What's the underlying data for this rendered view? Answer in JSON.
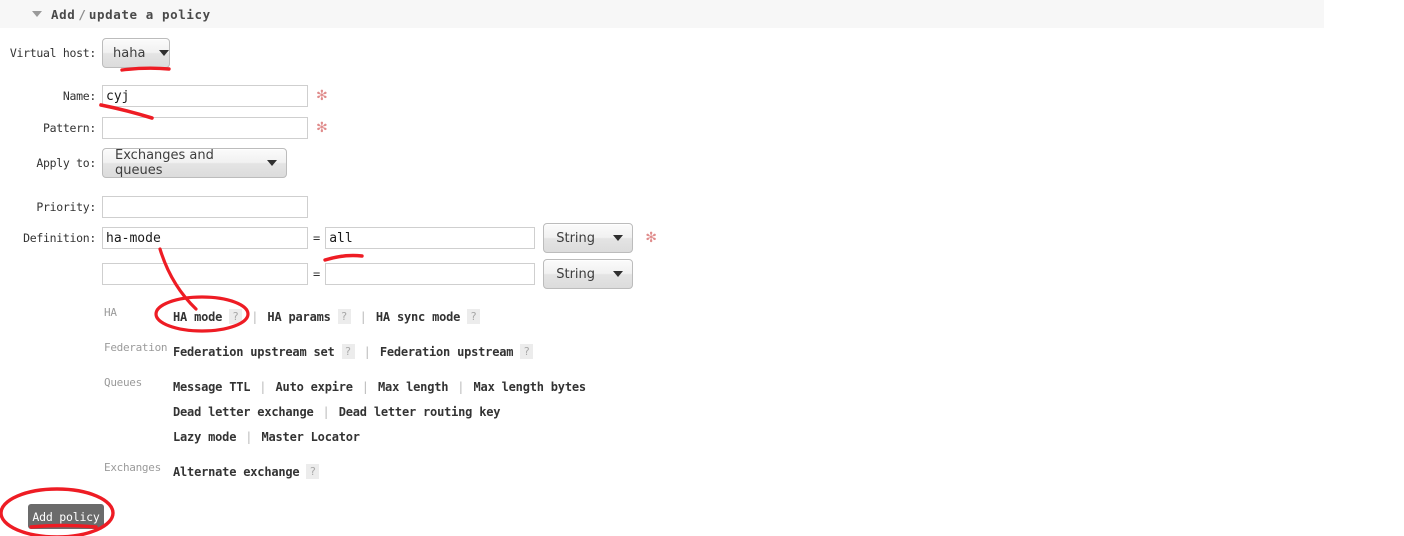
{
  "header": {
    "disclosure_icon": "triangle-down-icon",
    "title_first": "Add",
    "separator": "/",
    "title_rest": "update a policy"
  },
  "form": {
    "virtual_host": {
      "label": "Virtual host:",
      "value": "haha",
      "caret_icon": "chevron-down-icon"
    },
    "name": {
      "label": "Name:",
      "value": "cyj",
      "placeholder": "",
      "required_marker": "✻"
    },
    "pattern": {
      "label": "Pattern:",
      "value": "",
      "placeholder": "",
      "required_marker": "✻"
    },
    "apply_to": {
      "label": "Apply to:",
      "value": "Exchanges and queues",
      "caret_icon": "chevron-down-icon"
    },
    "priority": {
      "label": "Priority:",
      "value": "",
      "placeholder": ""
    },
    "definition": {
      "label": "Definition:",
      "required_marker": "✻",
      "equals": "=",
      "rows": [
        {
          "key": "ha-mode",
          "value": "all",
          "type": "String"
        },
        {
          "key": "",
          "value": "",
          "type": "String"
        }
      ]
    }
  },
  "groups": [
    {
      "label": "HA",
      "lines": [
        [
          {
            "text": "HA mode",
            "help": "?"
          },
          {
            "text": "HA params",
            "help": "?"
          },
          {
            "text": "HA sync mode",
            "help": "?"
          }
        ]
      ]
    },
    {
      "label": "Federation",
      "lines": [
        [
          {
            "text": "Federation upstream set",
            "help": "?"
          },
          {
            "text": "Federation upstream",
            "help": "?"
          }
        ]
      ]
    },
    {
      "label": "Queues",
      "lines": [
        [
          {
            "text": "Message TTL",
            "help": ""
          },
          {
            "text": "Auto expire",
            "help": ""
          },
          {
            "text": "Max length",
            "help": ""
          },
          {
            "text": "Max length bytes",
            "help": ""
          }
        ],
        [
          {
            "text": "Dead letter exchange",
            "help": ""
          },
          {
            "text": "Dead letter routing key",
            "help": ""
          }
        ],
        [
          {
            "text": "Lazy mode",
            "help": ""
          },
          {
            "text": "Master Locator",
            "help": ""
          }
        ]
      ]
    },
    {
      "label": "Exchanges",
      "lines": [
        [
          {
            "text": "Alternate exchange",
            "help": "?"
          }
        ]
      ]
    }
  ],
  "actions": {
    "add_policy_label": "Add policy"
  },
  "colors": {
    "annotation": "#ee1c24",
    "header_bar": "#f7f7f7",
    "required": "#e08c8c",
    "button": "#6b6b6b"
  },
  "annotations": {
    "vhost_underline": "red-underline-stroke",
    "name_underline": "red-underline-stroke",
    "value_underline": "red-underline-stroke",
    "ha_mode_ellipse": "red-ellipse-highlight",
    "ha_mode_arrow": "red-pointer-line",
    "add_policy_ellipse": "red-ellipse-highlight",
    "add_policy_underline": "red-underline-stroke"
  }
}
